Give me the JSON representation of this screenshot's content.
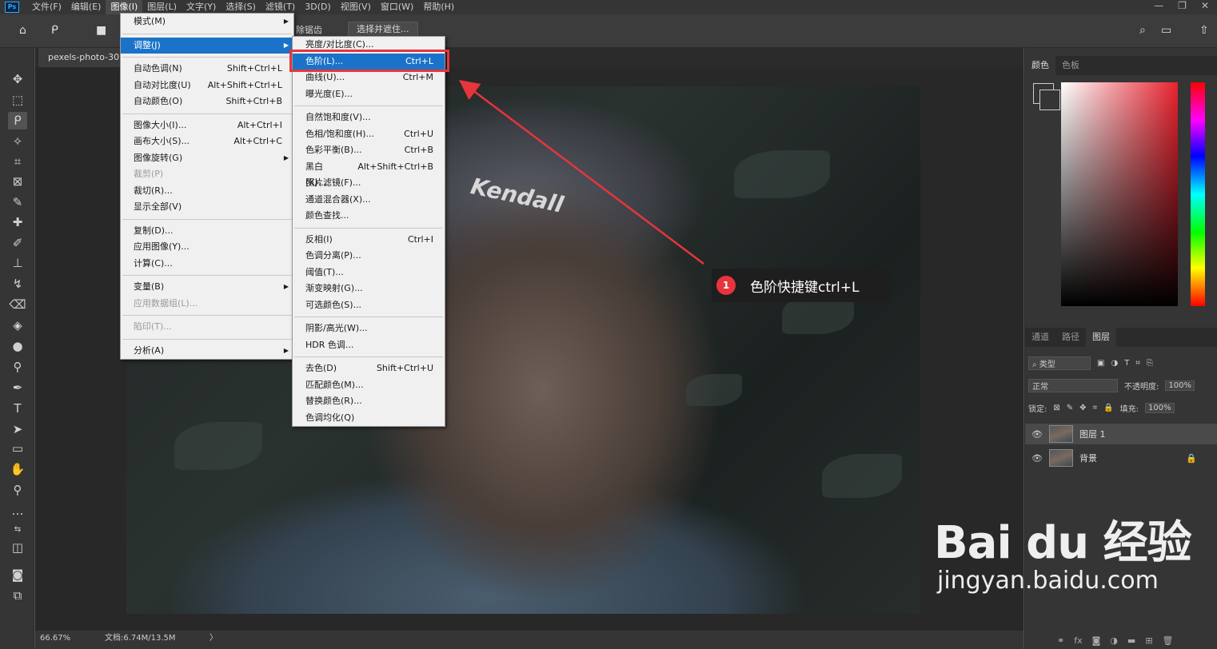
{
  "app_icon": "Ps",
  "menubar": [
    "文件(F)",
    "编辑(E)",
    "图像(I)",
    "图层(L)",
    "文字(Y)",
    "选择(S)",
    "滤镜(T)",
    "3D(D)",
    "视图(V)",
    "窗口(W)",
    "帮助(H)"
  ],
  "window_controls": [
    "—",
    "❐",
    "✕"
  ],
  "options_bar": {
    "antialias_label": "除锯齿",
    "select_mask_button": "选择并遮住..."
  },
  "document_tab": "pexels-photo-307",
  "status": {
    "zoom": "66.67%",
    "doc_info": "文档:6.74M/13.5M",
    "arrow": "〉"
  },
  "image_menu": [
    {
      "label": "模式(M)",
      "shortcut": "",
      "submenu": true
    },
    {
      "sep": true
    },
    {
      "label": "调整(J)",
      "shortcut": "",
      "submenu": true,
      "highlight": true
    },
    {
      "sep": true
    },
    {
      "label": "自动色调(N)",
      "shortcut": "Shift+Ctrl+L"
    },
    {
      "label": "自动对比度(U)",
      "shortcut": "Alt+Shift+Ctrl+L"
    },
    {
      "label": "自动颜色(O)",
      "shortcut": "Shift+Ctrl+B"
    },
    {
      "sep": true
    },
    {
      "label": "图像大小(I)...",
      "shortcut": "Alt+Ctrl+I"
    },
    {
      "label": "画布大小(S)...",
      "shortcut": "Alt+Ctrl+C"
    },
    {
      "label": "图像旋转(G)",
      "shortcut": "",
      "submenu": true
    },
    {
      "label": "裁剪(P)",
      "shortcut": "",
      "disabled": true
    },
    {
      "label": "裁切(R)...",
      "shortcut": ""
    },
    {
      "label": "显示全部(V)",
      "shortcut": ""
    },
    {
      "sep": true
    },
    {
      "label": "复制(D)...",
      "shortcut": ""
    },
    {
      "label": "应用图像(Y)...",
      "shortcut": ""
    },
    {
      "label": "计算(C)...",
      "shortcut": ""
    },
    {
      "sep": true
    },
    {
      "label": "变量(B)",
      "shortcut": "",
      "submenu": true
    },
    {
      "label": "应用数据组(L)...",
      "shortcut": "",
      "disabled": true
    },
    {
      "sep": true
    },
    {
      "label": "陷印(T)...",
      "shortcut": "",
      "disabled": true
    },
    {
      "sep": true
    },
    {
      "label": "分析(A)",
      "shortcut": "",
      "submenu": true
    }
  ],
  "adjust_menu": [
    {
      "label": "亮度/对比度(C)...",
      "shortcut": ""
    },
    {
      "label": "色阶(L)...",
      "shortcut": "Ctrl+L",
      "highlight": true
    },
    {
      "label": "曲线(U)...",
      "shortcut": "Ctrl+M"
    },
    {
      "label": "曝光度(E)...",
      "shortcut": ""
    },
    {
      "sep": true
    },
    {
      "label": "自然饱和度(V)...",
      "shortcut": ""
    },
    {
      "label": "色相/饱和度(H)...",
      "shortcut": "Ctrl+U"
    },
    {
      "label": "色彩平衡(B)...",
      "shortcut": "Ctrl+B"
    },
    {
      "label": "黑白(K)...",
      "shortcut": "Alt+Shift+Ctrl+B"
    },
    {
      "label": "照片滤镜(F)...",
      "shortcut": ""
    },
    {
      "label": "通道混合器(X)...",
      "shortcut": ""
    },
    {
      "label": "颜色查找...",
      "shortcut": ""
    },
    {
      "sep": true
    },
    {
      "label": "反相(I)",
      "shortcut": "Ctrl+I"
    },
    {
      "label": "色调分离(P)...",
      "shortcut": ""
    },
    {
      "label": "阈值(T)...",
      "shortcut": ""
    },
    {
      "label": "渐变映射(G)...",
      "shortcut": ""
    },
    {
      "label": "可选颜色(S)...",
      "shortcut": ""
    },
    {
      "sep": true
    },
    {
      "label": "阴影/高光(W)...",
      "shortcut": ""
    },
    {
      "label": "HDR 色调...",
      "shortcut": ""
    },
    {
      "sep": true
    },
    {
      "label": "去色(D)",
      "shortcut": "Shift+Ctrl+U"
    },
    {
      "label": "匹配颜色(M)...",
      "shortcut": ""
    },
    {
      "label": "替换颜色(R)...",
      "shortcut": ""
    },
    {
      "label": "色调均化(Q)",
      "shortcut": ""
    }
  ],
  "color_panel": {
    "tabs": [
      "颜色",
      "色板"
    ],
    "accent": "#e8232f"
  },
  "layers_panel": {
    "tabs": [
      "通道",
      "路径",
      "图层"
    ],
    "filter_kind": "类型",
    "blend_mode": "正常",
    "opacity_label": "不透明度:",
    "opacity": "100%",
    "lock_label": "锁定:",
    "fill_label": "填充:",
    "fill": "100%",
    "layers": [
      {
        "name": "图层 1",
        "selected": true,
        "locked": false
      },
      {
        "name": "背景",
        "selected": false,
        "locked": true
      }
    ],
    "bottom_icons": [
      "link-icon",
      "fx-icon",
      "mask-icon",
      "adjustment-icon",
      "folder-icon",
      "new-layer-icon",
      "trash-icon"
    ]
  },
  "photo": {
    "brand_text": "Kendall"
  },
  "callout": {
    "number": "1",
    "text": "色阶快捷键ctrl+L"
  },
  "watermark": {
    "line1": "Bai du 经验",
    "line2": "jingyan.baidu.com"
  }
}
